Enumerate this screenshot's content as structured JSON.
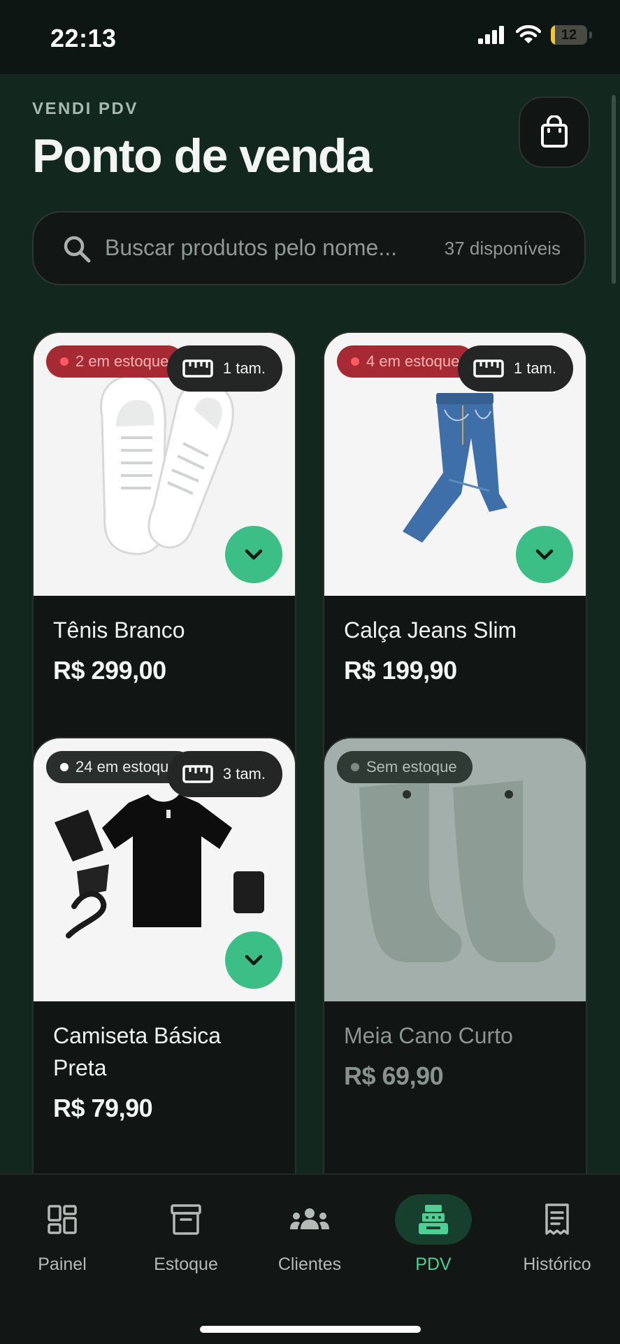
{
  "status": {
    "time": "22:13",
    "battery": "12",
    "battery_level": 0.12
  },
  "header": {
    "eyebrow": "VENDI PDV",
    "title": "Ponto de venda",
    "cart_icon": "shopping-bag-icon"
  },
  "search": {
    "placeholder": "Buscar produtos pelo nome...",
    "available": "37 disponíveis"
  },
  "products": [
    {
      "name": "Tênis Branco",
      "price": "R$ 299,00",
      "stock": "2 em estoque",
      "sizes": "1 tam.",
      "stock_status": "low"
    },
    {
      "name": "Calça Jeans Slim",
      "price": "R$ 199,90",
      "stock": "4 em estoque",
      "sizes": "1 tam.",
      "stock_status": "low"
    },
    {
      "name": "Camiseta Básica Preta",
      "price": "R$ 79,90",
      "stock": "24 em estoque",
      "sizes": "3 tam.",
      "stock_status": "ok"
    },
    {
      "name": "Meia Cano Curto",
      "price": "R$ 69,90",
      "stock": "Sem estoque",
      "sizes": "",
      "stock_status": "none"
    }
  ],
  "tabs": [
    {
      "label": "Painel",
      "icon": "dashboard-icon"
    },
    {
      "label": "Estoque",
      "icon": "archive-box-icon"
    },
    {
      "label": "Clientes",
      "icon": "group-icon"
    },
    {
      "label": "PDV",
      "icon": "cash-register-icon",
      "active": true
    },
    {
      "label": "Histórico",
      "icon": "receipt-icon"
    }
  ],
  "colors": {
    "accent": "#3cbf86",
    "background": "#12281f",
    "low_stock": "#a52a33"
  }
}
